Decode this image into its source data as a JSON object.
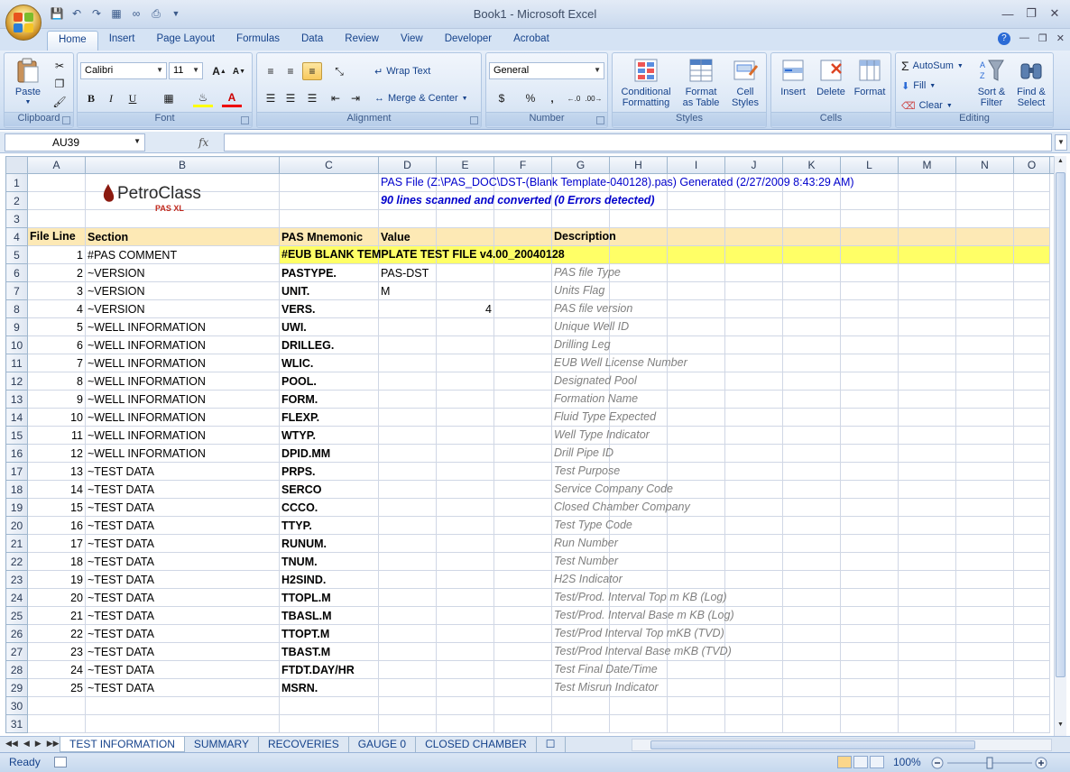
{
  "window": {
    "title": "Book1 - Microsoft Excel"
  },
  "qat": {
    "icons": [
      "save-icon",
      "undo-icon",
      "redo-icon",
      "excel-icon",
      "link-icon",
      "print-icon",
      "customize-icon"
    ]
  },
  "ribbon_tabs": [
    "Home",
    "Insert",
    "Page Layout",
    "Formulas",
    "Data",
    "Review",
    "View",
    "Developer",
    "Acrobat"
  ],
  "ribbon": {
    "clipboard": {
      "paste": "Paste",
      "label": "Clipboard"
    },
    "font": {
      "name": "Calibri",
      "size": "11",
      "label": "Font",
      "bold": "B",
      "italic": "I",
      "underline": "U"
    },
    "alignment": {
      "wrap": "Wrap Text",
      "merge": "Merge & Center",
      "label": "Alignment"
    },
    "number": {
      "format": "General",
      "currency": "$",
      "percent": "%",
      "comma": ",",
      "label": "Number"
    },
    "styles": {
      "cond1": "Conditional",
      "cond2": "Formatting",
      "fmt1": "Format",
      "fmt2": "as Table",
      "cell1": "Cell",
      "cell2": "Styles",
      "label": "Styles"
    },
    "cells": {
      "insert": "Insert",
      "delete": "Delete",
      "format": "Format",
      "label": "Cells"
    },
    "editing": {
      "autosum": "AutoSum",
      "fill": "Fill",
      "clear": "Clear",
      "sort1": "Sort &",
      "sort2": "Filter",
      "find1": "Find &",
      "find2": "Select",
      "label": "Editing"
    }
  },
  "formula_bar": {
    "name_box": "AU39",
    "fx": "fx",
    "value": ""
  },
  "columns": [
    "A",
    "B",
    "C",
    "D",
    "E",
    "F",
    "G",
    "H",
    "I",
    "J",
    "K",
    "L",
    "M",
    "N",
    "O"
  ],
  "rows": [
    "1",
    "2",
    "3",
    "4",
    "5",
    "6",
    "7",
    "8",
    "9",
    "10",
    "11",
    "12",
    "13",
    "14",
    "15",
    "16",
    "17",
    "18",
    "19",
    "20",
    "21",
    "22",
    "23",
    "24",
    "25",
    "26",
    "27",
    "28",
    "29",
    "30",
    "31"
  ],
  "logo": {
    "name": "PetroClass",
    "sub": "PAS XL"
  },
  "banner": {
    "line1": "PAS File (Z:\\PAS_DOC\\DST-(Blank Template-040128).pas)    Generated (2/27/2009 8:43:29 AM)",
    "line2": "90 lines scanned and converted (0 Errors detected)"
  },
  "header": {
    "file_line": "File Line",
    "section": "Section",
    "mnemonic": "PAS Mnemonic",
    "value": "Value",
    "description": "Description"
  },
  "comment_row": {
    "line": "1",
    "section": "#PAS COMMENT",
    "text": "#EUB BLANK TEMPLATE TEST FILE v4.00_20040128"
  },
  "data_rows": [
    {
      "line": "2",
      "section": "~VERSION",
      "mnemonic": "PASTYPE.",
      "value": "PAS-DST",
      "num": "",
      "desc": "PAS file Type"
    },
    {
      "line": "3",
      "section": "~VERSION",
      "mnemonic": "UNIT.",
      "value": "M",
      "num": "",
      "desc": "Units Flag"
    },
    {
      "line": "4",
      "section": "~VERSION",
      "mnemonic": "VERS.",
      "value": "",
      "num": "4",
      "desc": "PAS file version"
    },
    {
      "line": "5",
      "section": "~WELL INFORMATION",
      "mnemonic": "UWI.",
      "value": "",
      "num": "",
      "desc": "Unique Well ID"
    },
    {
      "line": "6",
      "section": "~WELL INFORMATION",
      "mnemonic": "DRILLEG.",
      "value": "",
      "num": "",
      "desc": "Drilling Leg"
    },
    {
      "line": "7",
      "section": "~WELL INFORMATION",
      "mnemonic": "WLIC.",
      "value": "",
      "num": "",
      "desc": "EUB Well License Number"
    },
    {
      "line": "8",
      "section": "~WELL INFORMATION",
      "mnemonic": "POOL.",
      "value": "",
      "num": "",
      "desc": "Designated Pool"
    },
    {
      "line": "9",
      "section": "~WELL INFORMATION",
      "mnemonic": "FORM.",
      "value": "",
      "num": "",
      "desc": "Formation Name"
    },
    {
      "line": "10",
      "section": "~WELL INFORMATION",
      "mnemonic": "FLEXP.",
      "value": "",
      "num": "",
      "desc": "Fluid Type Expected"
    },
    {
      "line": "11",
      "section": "~WELL INFORMATION",
      "mnemonic": "WTYP.",
      "value": "",
      "num": "",
      "desc": "Well Type Indicator"
    },
    {
      "line": "12",
      "section": "~WELL INFORMATION",
      "mnemonic": "DPID.MM",
      "value": "",
      "num": "",
      "desc": "Drill Pipe ID"
    },
    {
      "line": "13",
      "section": "~TEST DATA",
      "mnemonic": "PRPS.",
      "value": "",
      "num": "",
      "desc": "Test Purpose"
    },
    {
      "line": "14",
      "section": "~TEST DATA",
      "mnemonic": "SERCO",
      "value": "",
      "num": "",
      "desc": "Service Company Code"
    },
    {
      "line": "15",
      "section": "~TEST DATA",
      "mnemonic": "CCCO.",
      "value": "",
      "num": "",
      "desc": "Closed Chamber Company"
    },
    {
      "line": "16",
      "section": "~TEST DATA",
      "mnemonic": "TTYP.",
      "value": "",
      "num": "",
      "desc": "Test Type Code"
    },
    {
      "line": "17",
      "section": "~TEST DATA",
      "mnemonic": "RUNUM.",
      "value": "",
      "num": "",
      "desc": "Run Number"
    },
    {
      "line": "18",
      "section": "~TEST DATA",
      "mnemonic": "TNUM.",
      "value": "",
      "num": "",
      "desc": "Test Number"
    },
    {
      "line": "19",
      "section": "~TEST DATA",
      "mnemonic": "H2SIND.",
      "value": "",
      "num": "",
      "desc": "H2S Indicator"
    },
    {
      "line": "20",
      "section": "~TEST DATA",
      "mnemonic": "TTOPL.M",
      "value": "",
      "num": "",
      "desc": "Test/Prod. Interval Top m KB (Log)"
    },
    {
      "line": "21",
      "section": "~TEST DATA",
      "mnemonic": "TBASL.M",
      "value": "",
      "num": "",
      "desc": "Test/Prod. Interval Base m KB (Log)"
    },
    {
      "line": "22",
      "section": "~TEST DATA",
      "mnemonic": "TTOPT.M",
      "value": "",
      "num": "",
      "desc": "Test/Prod Interval Top mKB (TVD)"
    },
    {
      "line": "23",
      "section": "~TEST DATA",
      "mnemonic": "TBAST.M",
      "value": "",
      "num": "",
      "desc": "Test/Prod Interval Base mKB (TVD)"
    },
    {
      "line": "24",
      "section": "~TEST DATA",
      "mnemonic": "FTDT.DAY/HR",
      "value": "",
      "num": "",
      "desc": "Test Final Date/Time"
    },
    {
      "line": "25",
      "section": "~TEST DATA",
      "mnemonic": "MSRN.",
      "value": "",
      "num": "",
      "desc": "Test Misrun Indicator"
    }
  ],
  "sheet_tabs": [
    "TEST INFORMATION",
    "SUMMARY",
    "RECOVERIES",
    "GAUGE 0",
    "CLOSED CHAMBER"
  ],
  "status": {
    "text": "Ready",
    "zoom": "100%",
    "zoom_level": 1.0
  },
  "colors": {
    "header_fill": "#fde9b5",
    "comment_fill": "#ffff66",
    "banner_text": "#0000cc",
    "desc_text": "#7f7f7f"
  }
}
